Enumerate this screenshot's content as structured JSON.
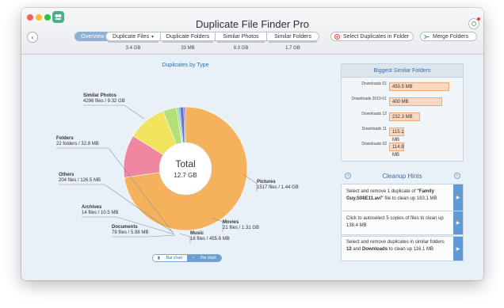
{
  "window": {
    "title": "Duplicate File Finder Pro"
  },
  "traffic_lights": {
    "close": "#fe5f57",
    "minimize": "#febc2e",
    "maximize": "#28c840"
  },
  "toolbar": {
    "overview_label": "Overview",
    "segments": [
      {
        "label": "Duplicate Files",
        "size": "3.4 GB",
        "has_dropdown": true
      },
      {
        "label": "Duplicate Folders",
        "size": "33 MB"
      },
      {
        "label": "Similar Photos",
        "size": "9.3 GB"
      },
      {
        "label": "Similar Folders",
        "size": "1.7 GB"
      }
    ],
    "select_duplicates_label": "Select Duplicates in Folder",
    "merge_folders_label": "Merge Folders"
  },
  "chart_title": "Duplicates by Type",
  "chart_data": {
    "type": "pie",
    "title": "Duplicates by Type",
    "center_title": "Total",
    "center_value": "12.7 GB",
    "slices": [
      {
        "name": "Similar Photos",
        "detail": "4296 files / 9.32 GB",
        "value": 9.32,
        "color": "#f4b25c"
      },
      {
        "name": "Pictures",
        "detail": "1517 files / 1.44 GB",
        "value": 1.44,
        "color": "#ee879f"
      },
      {
        "name": "Movies",
        "detail": "21 files / 1.31 GB",
        "value": 1.31,
        "color": "#f2e35f"
      },
      {
        "name": "Music",
        "detail": "18 files / 455.6 MB",
        "value": 0.4556,
        "color": "#b4e07a"
      },
      {
        "name": "Documents",
        "detail": "79 files / 5.98 MB",
        "value": 0.00598,
        "color": "#8fc9c9"
      },
      {
        "name": "Archives",
        "detail": "14 files / 10.5 MB",
        "value": 0.0105,
        "color": "#7cc27c"
      },
      {
        "name": "Others",
        "detail": "204 files / 126.5 MB",
        "value": 0.1265,
        "color": "#5a77d6"
      },
      {
        "name": "Folders",
        "detail": "22 folders / 32.8 MB",
        "value": 0.0328,
        "color": "#a866d8"
      }
    ]
  },
  "view_toggle": {
    "bar_label": "Bar chart",
    "pie_label": "Pie chart"
  },
  "similar_folders": {
    "title": "Biggest Similar Folders",
    "bar_color": "#fbd9c0",
    "items": [
      {
        "name": "Downloads 01",
        "size": "450.5 MB",
        "value": 450.5
      },
      {
        "name": "Downloads 2019-01",
        "size": "400 MB",
        "value": 400
      },
      {
        "name": "Downloads 12",
        "size": "232.3 MB",
        "value": 232.3
      },
      {
        "name": "Downloads 11",
        "size": "115.1 MB",
        "value": 115.1
      },
      {
        "name": "Downloads 02",
        "size": "114.9 MB",
        "value": 114.9
      }
    ]
  },
  "cleanup_hints": {
    "title": "Cleanup Hints",
    "prev_icon": "chevron-left-icon",
    "next_icon": "chevron-right-icon",
    "hints": [
      {
        "parts": [
          {
            "text": "Select and remove 1 duplicate of "
          },
          {
            "text": "\"Family Guy.S08E11.avi\"",
            "bold": true
          },
          {
            "text": " file to clean up 183.1 MB"
          }
        ]
      },
      {
        "parts": [
          {
            "text": "Click to autoselect 5 copies of files to clean up 138.4 MB"
          }
        ]
      },
      {
        "parts": [
          {
            "text": "Select and remove duplicates in similar folders "
          },
          {
            "text": "12",
            "bold": true
          },
          {
            "text": " and "
          },
          {
            "text": "Downloads",
            "bold": true
          },
          {
            "text": " to clean up 116.1 MB"
          }
        ]
      }
    ]
  }
}
